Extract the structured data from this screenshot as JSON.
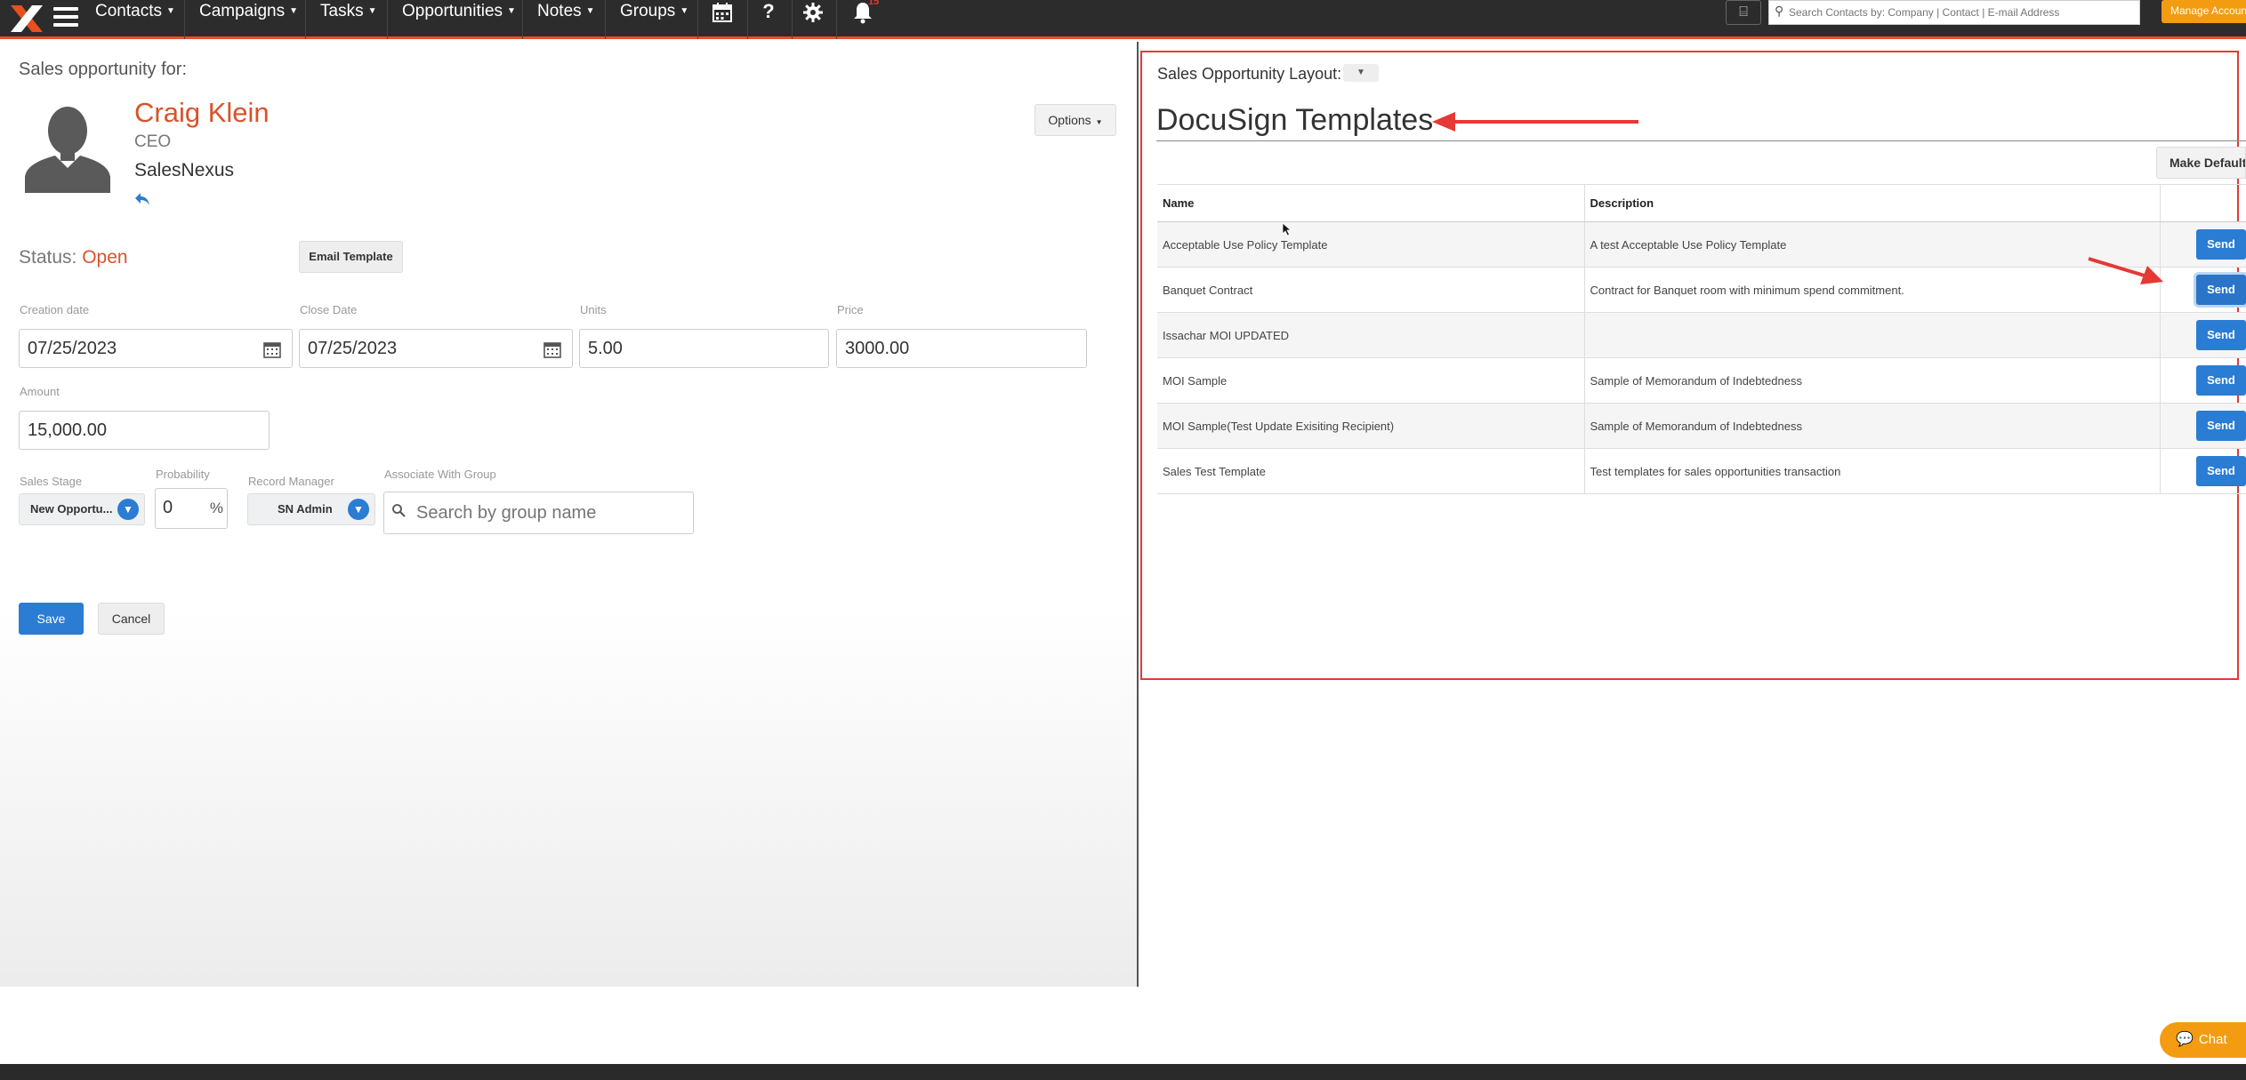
{
  "nav": {
    "items": [
      {
        "label": "Contacts"
      },
      {
        "label": "Campaigns"
      },
      {
        "label": "Tasks"
      },
      {
        "label": "Opportunities"
      },
      {
        "label": "Notes"
      },
      {
        "label": "Groups"
      }
    ],
    "notification_count": "15",
    "search_placeholder": "Search Contacts by: Company | Contact | E-mail Address",
    "manage_label": "Manage Account"
  },
  "left": {
    "heading": "Sales opportunity for:",
    "contact": {
      "name": "Craig Klein",
      "title": "CEO",
      "company": "SalesNexus"
    },
    "options_label": "Options",
    "status_label": "Status:",
    "status_value": "Open",
    "email_template_label": "Email Template",
    "fields": {
      "creation_date": {
        "label": "Creation date",
        "value": "07/25/2023"
      },
      "close_date": {
        "label": "Close Date",
        "value": "07/25/2023"
      },
      "units": {
        "label": "Units",
        "value": "5.00"
      },
      "price": {
        "label": "Price",
        "value": "3000.00"
      },
      "amount": {
        "label": "Amount",
        "value": "15,000.00"
      },
      "sales_stage": {
        "label": "Sales Stage",
        "value": "New Opportu..."
      },
      "probability": {
        "label": "Probability",
        "value": "0",
        "unit": "%"
      },
      "record_manager": {
        "label": "Record Manager",
        "value": "SN Admin"
      },
      "associate_group": {
        "label": "Associate With Group",
        "placeholder": "Search by group name"
      }
    },
    "save_label": "Save",
    "cancel_label": "Cancel"
  },
  "right": {
    "layout_label": "Sales Opportunity Layout:",
    "title": "DocuSign Templates",
    "make_default_label": "Make Default",
    "columns": [
      "Name",
      "Description",
      ""
    ],
    "rows": [
      {
        "name": "Acceptable Use Policy Template",
        "description": "A test Acceptable Use Policy Template",
        "action": "Send"
      },
      {
        "name": "Banquet Contract",
        "description": "Contract for Banquet room with minimum spend commitment.",
        "action": "Send"
      },
      {
        "name": "Issachar MOI UPDATED",
        "description": "",
        "action": "Send"
      },
      {
        "name": "MOI Sample",
        "description": "Sample of Memorandum of Indebtedness",
        "action": "Send"
      },
      {
        "name": "MOI Sample(Test Update Exisiting Recipient)",
        "description": "Sample of Memorandum of Indebtedness",
        "action": "Send"
      },
      {
        "name": "Sales Test Template",
        "description": "Test templates for sales opportunities transaction",
        "action": "Send"
      }
    ]
  },
  "chat_label": "Chat",
  "colors": {
    "brand_orange": "#e8501e",
    "name_red": "#d9522b",
    "primary_blue": "#2b7cd3",
    "annotation_red": "#e53935",
    "accent_yellow": "#f39c12"
  }
}
